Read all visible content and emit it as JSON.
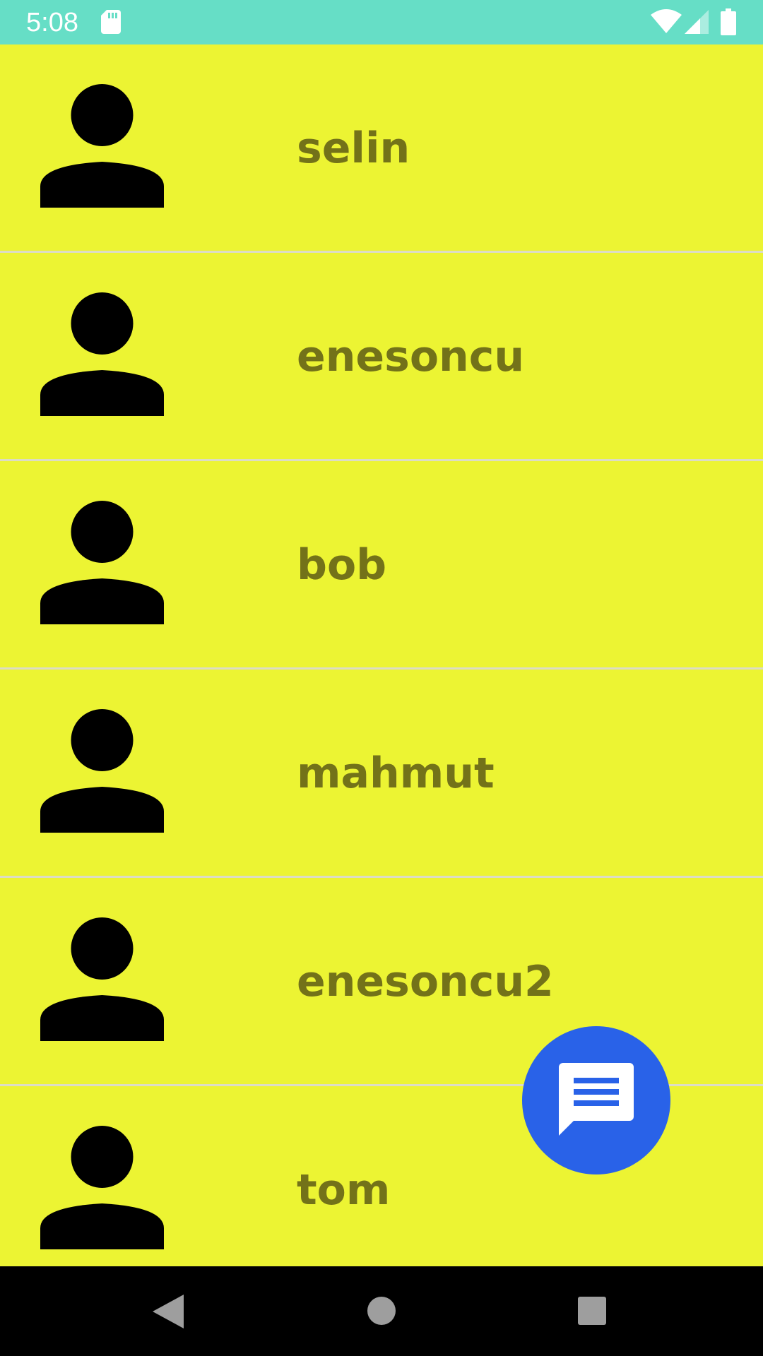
{
  "status_bar": {
    "time": "5:08",
    "icons": [
      "sd-card-icon",
      "wifi-icon",
      "cell-signal-icon",
      "battery-icon"
    ],
    "background": "#66dec6"
  },
  "contacts": [
    {
      "name": "selin",
      "icon": "person-icon"
    },
    {
      "name": "enesoncu",
      "icon": "person-icon"
    },
    {
      "name": "bob",
      "icon": "person-icon"
    },
    {
      "name": "mahmut",
      "icon": "person-icon"
    },
    {
      "name": "enesoncu2",
      "icon": "person-icon"
    },
    {
      "name": "tom",
      "icon": "person-icon"
    }
  ],
  "fab": {
    "icon": "message-icon",
    "color": "#2962e8"
  },
  "nav_bar": {
    "buttons": [
      "back-icon",
      "home-icon",
      "recents-icon"
    ]
  },
  "colors": {
    "list_background": "#ecf433",
    "name_text": "#737219",
    "divider": "#dcdcc4"
  }
}
